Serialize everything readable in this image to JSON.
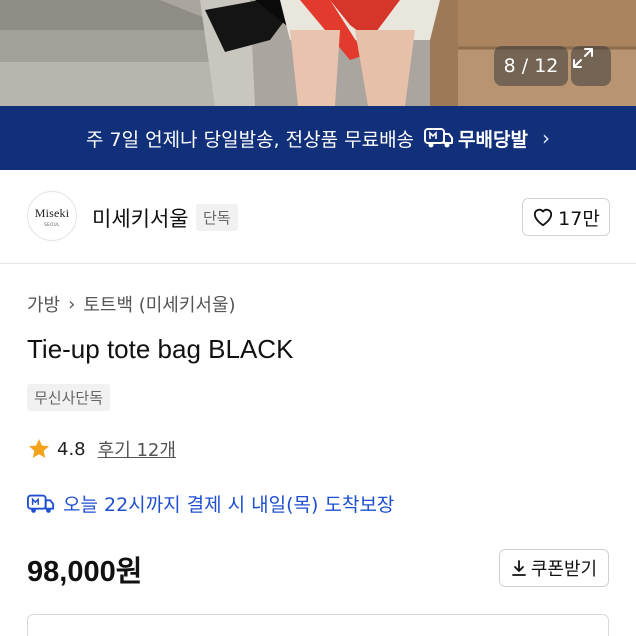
{
  "hero": {
    "counter": "8 / 12"
  },
  "banner": {
    "text": "주 7일 언제나 당일발송, 전상품 무료배송",
    "brand_label": "무배당발",
    "chevron": "›"
  },
  "brand": {
    "logo_main": "Miseki",
    "logo_sub": "SEOUL",
    "name": "미세키서울",
    "tag": "단독",
    "likes": "17만"
  },
  "product": {
    "breadcrumb": [
      "가방",
      "토트백 (미세키서울)"
    ],
    "breadcrumb_sep": "›",
    "title": "Tie-up tote bag BLACK",
    "badge": "무신사단독",
    "rating": "4.8",
    "reviews": "후기 12개",
    "delivery_notice": "오늘 22시까지 결제 시 내일(목) 도착보장",
    "price": "98,000원",
    "coupon_label": "쿠폰받기"
  },
  "colors": {
    "banner_bg": "#12307a",
    "delivery_blue": "#1f4fd1",
    "star": "#f3a31b"
  }
}
